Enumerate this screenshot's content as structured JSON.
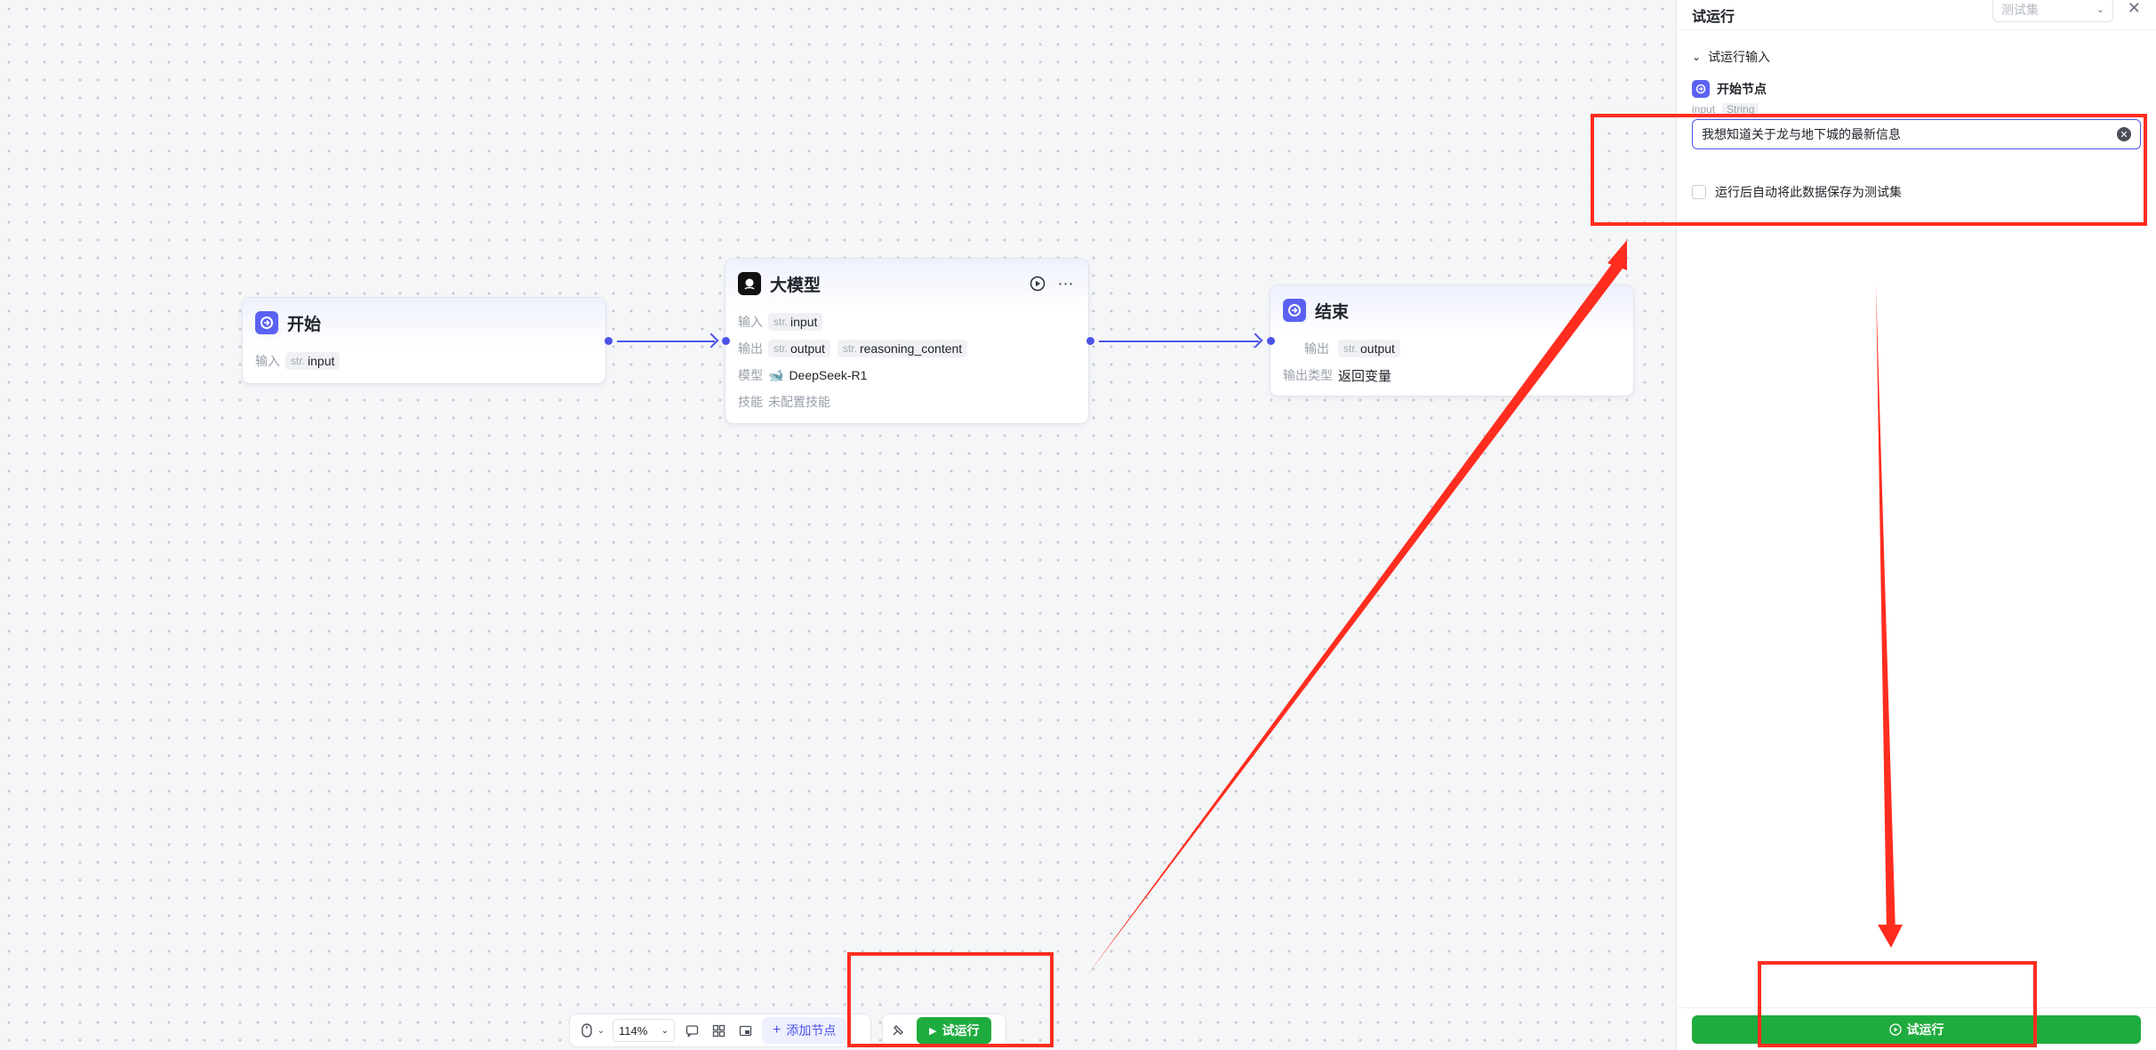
{
  "canvas": {
    "nodes": {
      "start": {
        "title": "开始",
        "input_label": "输入",
        "input_type": "str.",
        "input_name": "input"
      },
      "llm": {
        "title": "大模型",
        "input_label": "输入",
        "input_type": "str.",
        "input_name": "input",
        "output_label": "输出",
        "outputs": [
          {
            "type": "str.",
            "name": "output"
          },
          {
            "type": "str.",
            "name": "reasoning_content"
          }
        ],
        "model_label": "模型",
        "model_name": "DeepSeek-R1",
        "skill_label": "技能",
        "skill_value": "未配置技能"
      },
      "end": {
        "title": "结束",
        "output_label": "输出",
        "output_type": "str.",
        "output_name": "output",
        "output_kind_label": "输出类型",
        "output_kind_value": "返回变量"
      }
    },
    "toolbar": {
      "zoom": "114%",
      "add_node": "添加节点",
      "run": "试运行"
    }
  },
  "panel": {
    "title": "试运行",
    "testset_placeholder": "测试集",
    "section_title": "试运行输入",
    "start_node_label": "开始节点",
    "var_name": "input",
    "var_type": "String",
    "input_value": "我想知道关于龙与地下城的最新信息",
    "save_checkbox_label": "运行后自动将此数据保存为测试集",
    "run_button": "试运行"
  },
  "colors": {
    "accent": "#4d53e8",
    "run_green": "#1fac3f",
    "annotation_red": "#ff2d1f"
  }
}
